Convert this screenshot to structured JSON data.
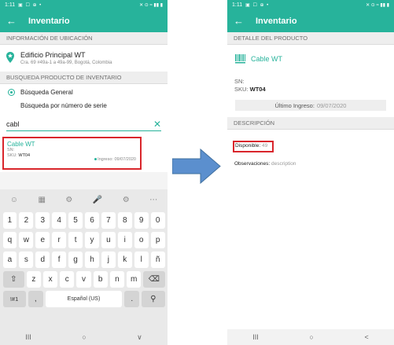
{
  "left": {
    "status_time": "1:11",
    "status_dots": "▣ ☐ ⊕ •",
    "status_right": "✕ ⊙ ≈ ▮▮ ▮",
    "app_title": "Inventario",
    "section_location": "INFORMACIÓN DE UBICACIÓN",
    "location_name": "Edificio Principal WT",
    "location_address": "Cra. 69 #49a-1 a 49a-99, Bogotá, Colombia",
    "section_search": "BUSQUEDA PRODUCTO DE INVENTARIO",
    "radio_general": "Búsqueda General",
    "radio_serial": "Búsqueda por número de serie",
    "search_value": "cabl",
    "result": {
      "name": "Cable WT",
      "sn_label": "SN:",
      "sku_label": "SKU:",
      "sku_value": "WT04",
      "ingreso": "Ingreso: 09/07/2020"
    },
    "keyboard": {
      "tools": [
        "☺",
        "▦",
        "⚙",
        "🎤",
        "⚙",
        "⋯"
      ],
      "row_numbers": [
        "1",
        "2",
        "3",
        "4",
        "5",
        "6",
        "7",
        "8",
        "9",
        "0"
      ],
      "row_q": [
        "q",
        "w",
        "e",
        "r",
        "t",
        "y",
        "u",
        "i",
        "o",
        "p"
      ],
      "row_a": [
        "a",
        "s",
        "d",
        "f",
        "g",
        "h",
        "j",
        "k",
        "l",
        "ñ"
      ],
      "row_z": [
        "z",
        "x",
        "c",
        "v",
        "b",
        "n",
        "m"
      ],
      "shift": "⇧",
      "backspace": "⌫",
      "sym": "!#1",
      "comma": ",",
      "space": "Español (US)",
      "period": ".",
      "search": "⚲"
    },
    "nav": [
      "III",
      "○",
      "∨"
    ]
  },
  "right": {
    "status_time": "1:11",
    "status_dots": "▣ ☐ ⊕ •",
    "status_right": "✕ ⊙ ≈ ▮▮ ▮",
    "app_title": "Inventario",
    "section_detail": "DETALLE DEL PRODUCTO",
    "product_name": "Cable WT",
    "sn_label": "SN:",
    "sku_label": "SKU:",
    "sku_value": "WT04",
    "ultimo_label": "Último Ingreso:",
    "ultimo_value": "09/07/2020",
    "section_desc": "DESCRIPCIÓN",
    "disponible_label": "Disponible:",
    "disponible_value": "49",
    "observaciones_label": "Observaciones:",
    "observaciones_value": "description",
    "nav": [
      "III",
      "○",
      "<"
    ]
  },
  "colors": {
    "accent": "#27b39b",
    "highlight": "#d9262c",
    "arrow": "#5b8fce"
  }
}
